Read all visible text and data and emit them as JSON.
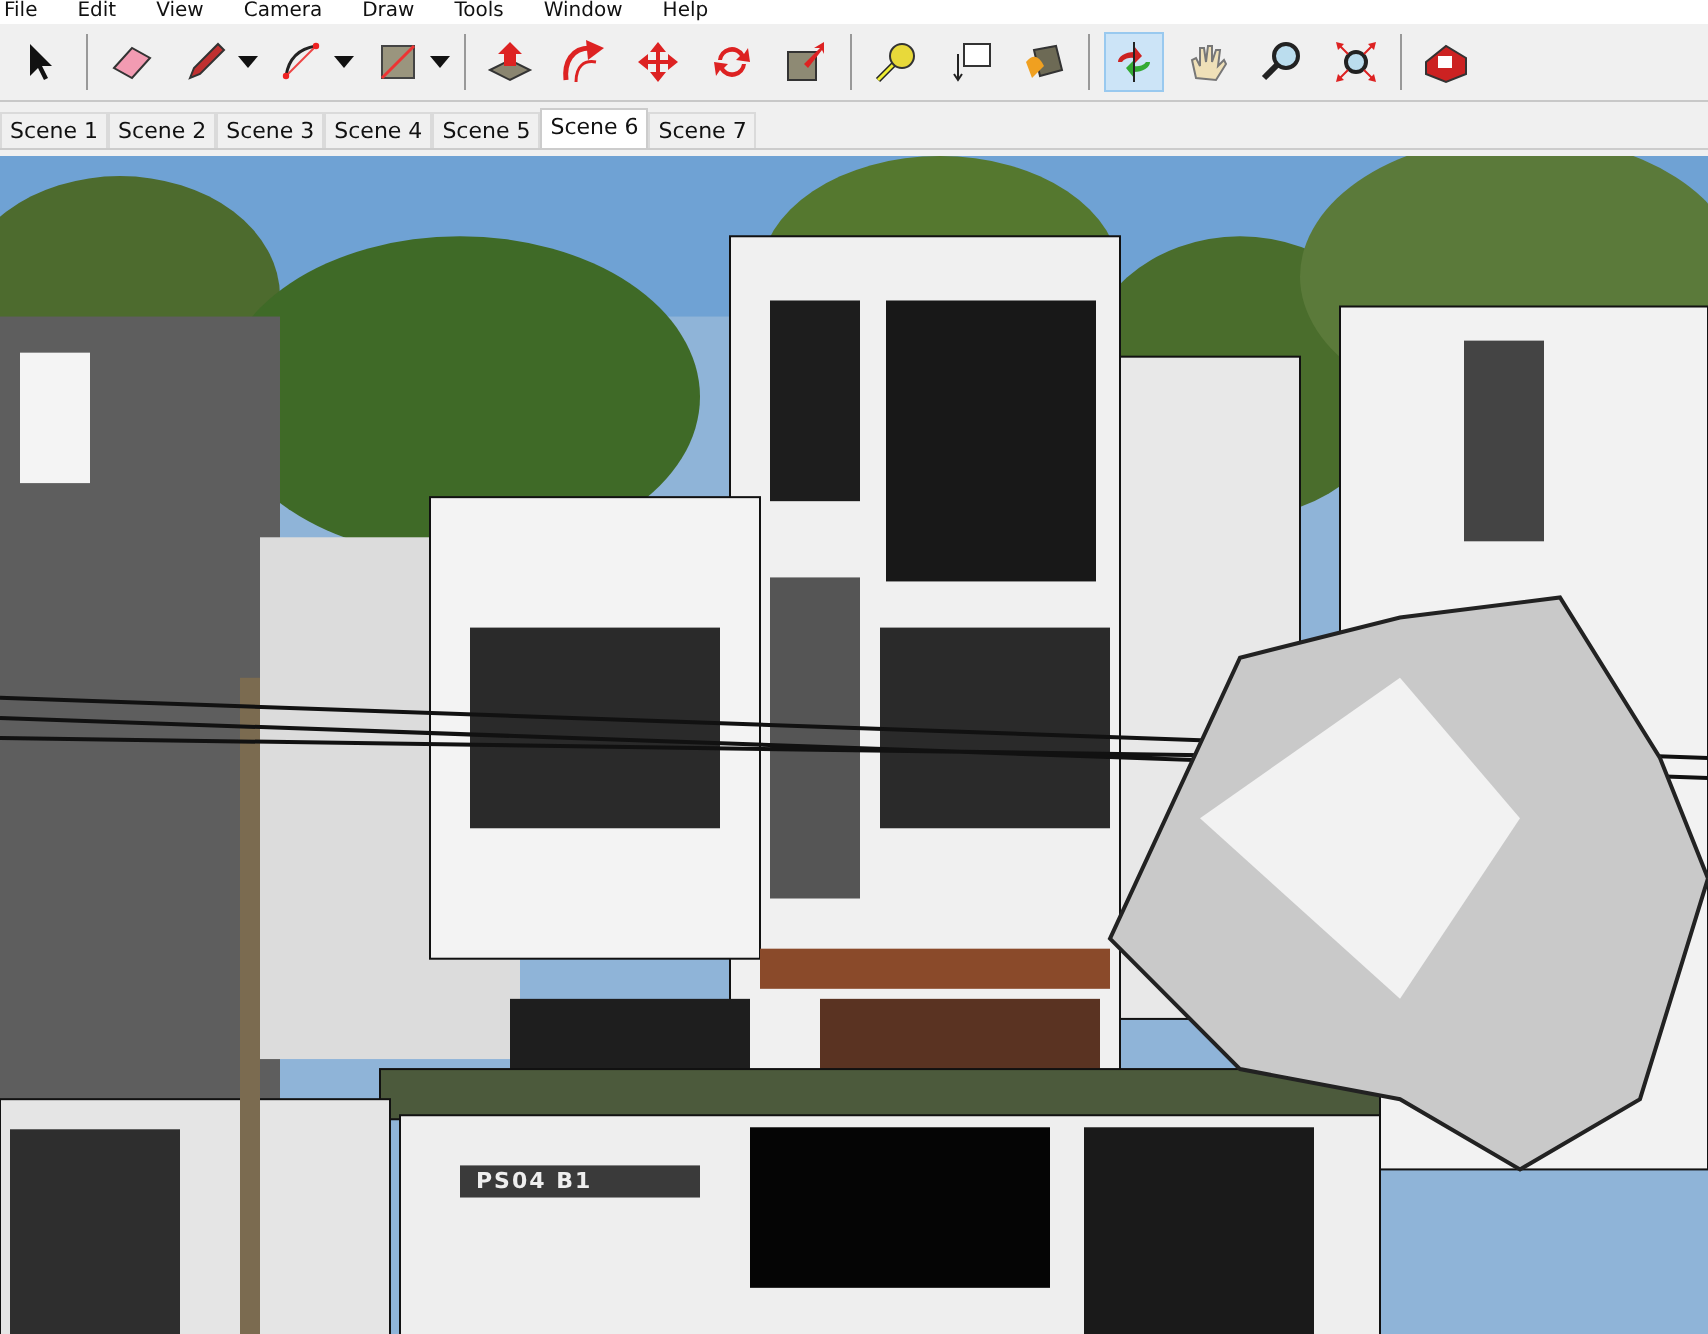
{
  "menu": [
    "File",
    "Edit",
    "View",
    "Camera",
    "Draw",
    "Tools",
    "Window",
    "Help"
  ],
  "toolbar": {
    "groups": [
      [
        {
          "selected": false,
          "dropdown": false
        }
      ],
      [
        {
          "selected": false,
          "dropdown": false
        },
        {
          "selected": false,
          "dropdown": true
        },
        {
          "selected": false,
          "dropdown": true
        },
        {
          "selected": false,
          "dropdown": true
        }
      ],
      [
        {
          "selected": false,
          "dropdown": false
        },
        {
          "selected": false,
          "dropdown": false
        },
        {
          "selected": false,
          "dropdown": false
        },
        {
          "selected": false,
          "dropdown": false
        },
        {
          "selected": false,
          "dropdown": false
        }
      ],
      [
        {
          "selected": false,
          "dropdown": false
        },
        {
          "selected": false,
          "dropdown": false
        },
        {
          "selected": false,
          "dropdown": false
        }
      ],
      [
        {
          "selected": true,
          "dropdown": false
        },
        {
          "selected": false,
          "dropdown": false
        },
        {
          "selected": false,
          "dropdown": false
        },
        {
          "selected": false,
          "dropdown": false
        }
      ],
      [
        {
          "selected": false,
          "dropdown": false
        }
      ]
    ]
  },
  "scenes": [
    {
      "label": "Scene 1",
      "selected": false
    },
    {
      "label": "Scene 2",
      "selected": false
    },
    {
      "label": "Scene 3",
      "selected": false
    },
    {
      "label": "Scene 4",
      "selected": false
    },
    {
      "label": "Scene 5",
      "selected": false
    },
    {
      "label": "Scene 6",
      "selected": true
    },
    {
      "label": "Scene 7",
      "selected": false
    }
  ],
  "viewport": {
    "sign_text": "PS04 B1"
  }
}
